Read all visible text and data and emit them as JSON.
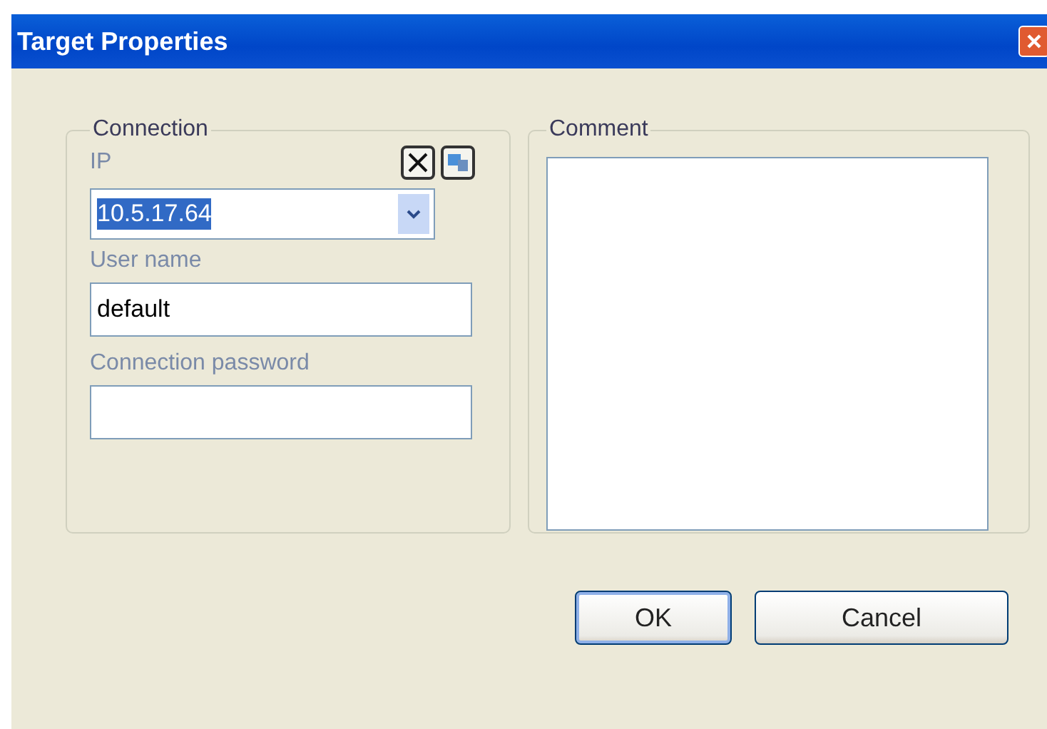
{
  "window": {
    "title": "Target Properties"
  },
  "connection": {
    "title": "Connection",
    "ip_label": "IP",
    "ip": {
      "value": "10.5.17.64",
      "text_selected": true
    },
    "user_label": "User name",
    "user": {
      "value": "default"
    },
    "password_label": "Connection password"
  },
  "comment": {
    "title": "Comment"
  },
  "buttons": [
    {
      "label": "OK",
      "default": true
    },
    {
      "label": "Cancel",
      "default": false
    }
  ]
}
